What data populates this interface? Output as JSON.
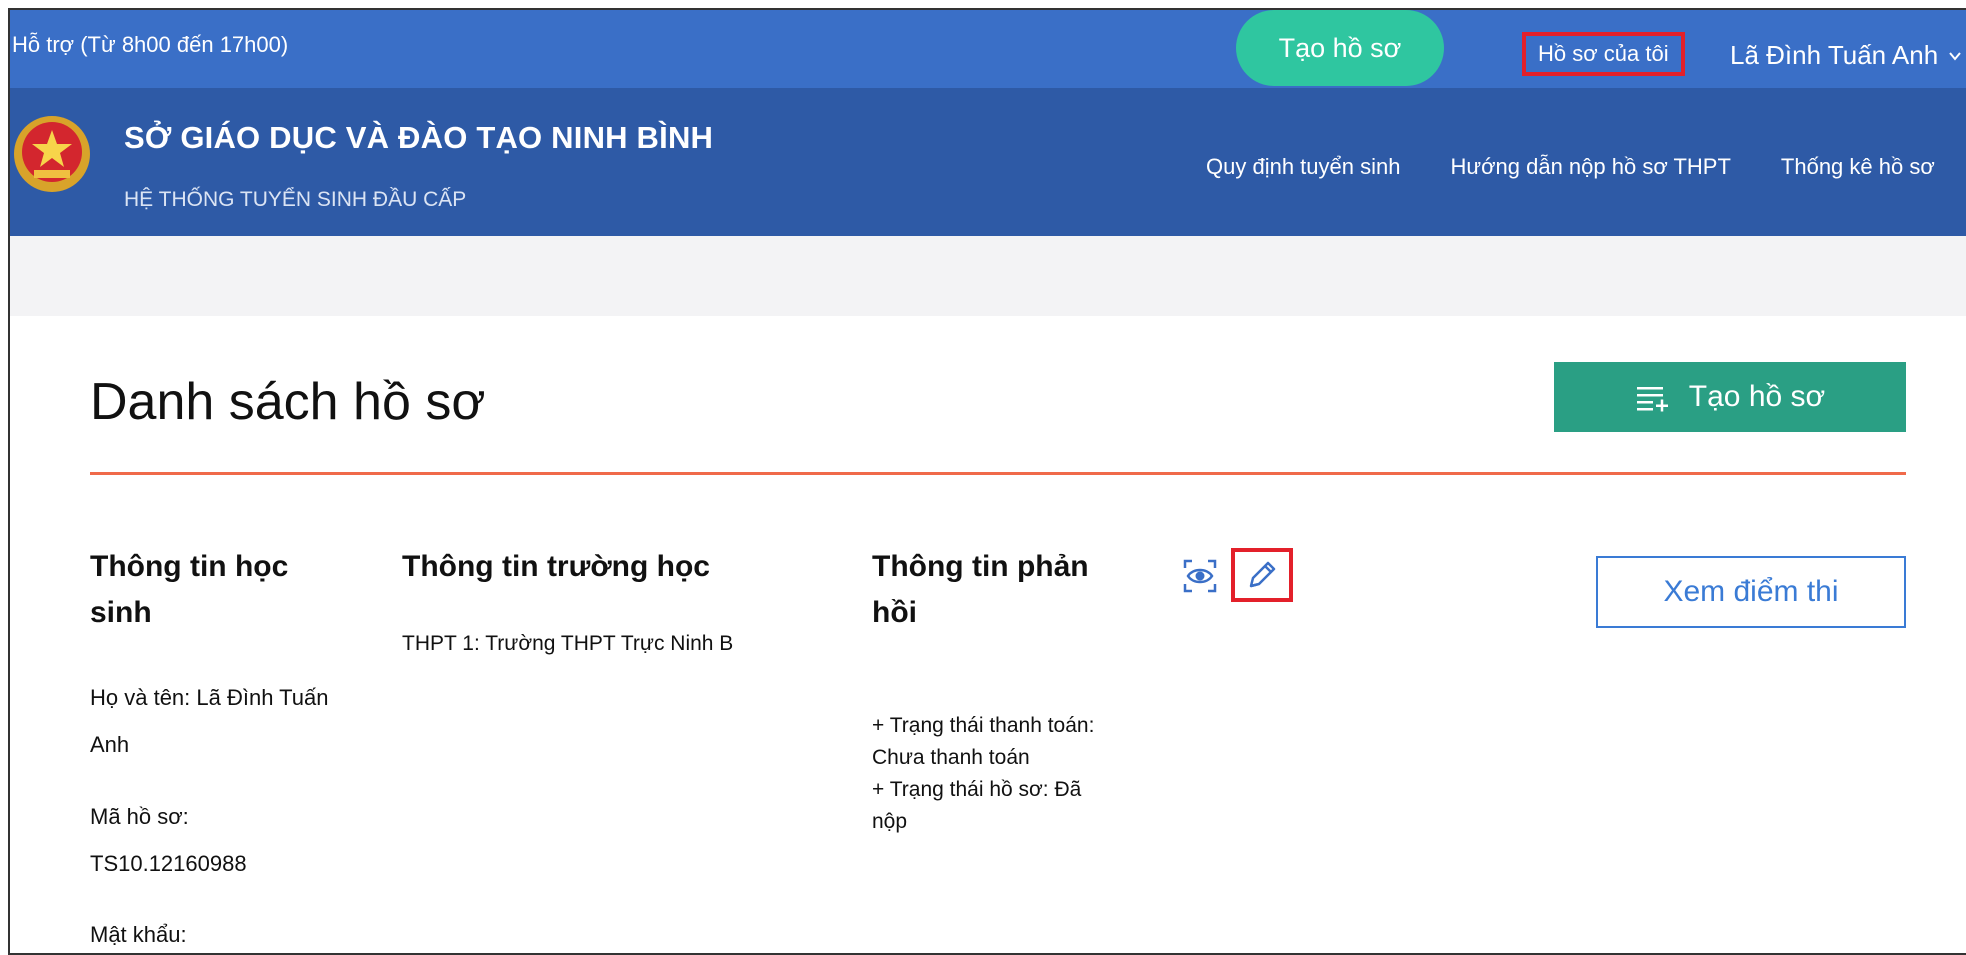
{
  "topbar": {
    "support": "Hỗ trợ (Từ 8h00 đến 17h00)",
    "create_pill": "Tạo hồ sơ",
    "my_profile": "Hồ sơ của tôi",
    "user_name": "Lã Đình Tuấn Anh",
    "bg_color": "#3a6fc7",
    "pill_color": "#2fc6a0"
  },
  "header": {
    "org_title": "SỞ GIÁO DỤC VÀ ĐÀO TẠO NINH BÌNH",
    "org_subtitle": "HỆ THỐNG TUYỂN SINH ĐẦU CẤP",
    "nav": [
      "Quy định tuyển sinh",
      "Hướng dẫn nộp hồ sơ THPT",
      "Thống kê hồ sơ"
    ],
    "bg_color": "#2e5aa6"
  },
  "main": {
    "page_title": "Danh sách hồ sơ",
    "create_button": "Tạo hồ sơ",
    "score_button": "Xem điểm thi",
    "accent_color": "#f06a4a",
    "button_color": "#2a9f84",
    "columns": {
      "student_head_1": "Thông tin học",
      "student_head_2": "sinh",
      "school_head": "Thông tin trường học",
      "feedback_head_1": "Thông tin phản",
      "feedback_head_2": "hồi"
    },
    "student": {
      "name_line_1": "Họ và tên: Lã Đình Tuấn",
      "name_line_2": "Anh",
      "code_label": "Mã hồ sơ:",
      "code_value": "TS10.12160988",
      "password_label": "Mật khẩu:"
    },
    "school": {
      "choice_1": "THPT 1: Trường THPT Trực Ninh B"
    },
    "feedback": {
      "line_1": "+ Trạng thái thanh toán:",
      "line_2": "Chưa thanh toán",
      "line_3": "+ Trạng thái hồ sơ: Đã",
      "line_4": "nộp"
    },
    "icons": [
      "eye-icon",
      "pencil-icon",
      "list-add-icon",
      "emblem-icon",
      "chevron-down-icon"
    ]
  }
}
